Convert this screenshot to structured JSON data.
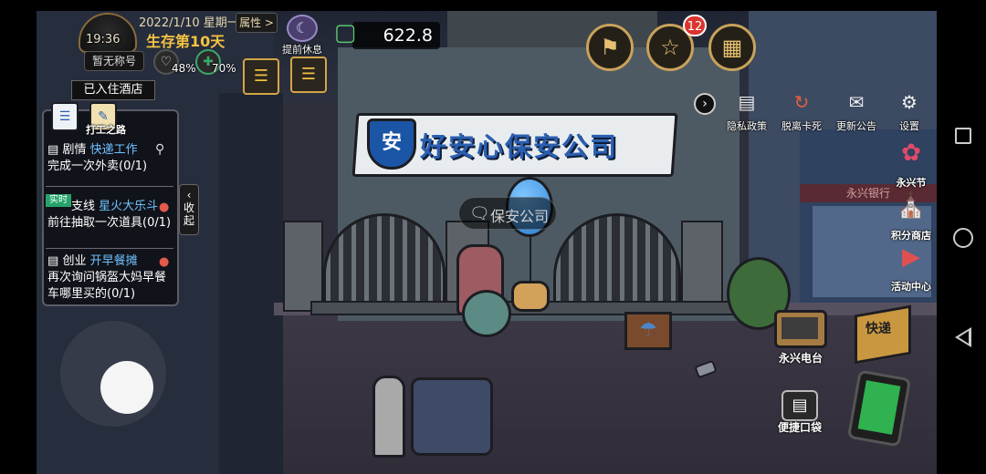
{
  "hud": {
    "time": "19:36",
    "date": "2022/1/10 星期一",
    "survival_day": "生存第10天",
    "attributes_label": "属性 >",
    "player_title": "暂无称号",
    "hunger_pct": "48%",
    "health_pct": "70%",
    "rest_label": "提前休息",
    "money": "622.8",
    "notification_count": "12"
  },
  "scene": {
    "company_sign": "好安心保安公司",
    "sign_emblem": "安",
    "location_bubble": "保安公司",
    "bank_sign": "永兴银行",
    "location_status": "已入住酒店"
  },
  "tasks": {
    "tab_label": "打工之路",
    "items": [
      {
        "type": "剧情",
        "name": "快递工作",
        "desc": "完成一次外卖(0/1)"
      },
      {
        "type": "支线",
        "name": "星火大乐斗",
        "desc": "前往抽取一次道具(0/1)",
        "tag": "实时"
      },
      {
        "type": "创业",
        "name": "开早餐摊",
        "desc": "再次询问锅盔大妈早餐车哪里买的(0/1)"
      }
    ],
    "collapse_label": "收起"
  },
  "top_menu": [
    {
      "label": "隐私政策",
      "icon": "document-icon"
    },
    {
      "label": "脱离卡死",
      "icon": "unstuck-icon"
    },
    {
      "label": "更新公告",
      "icon": "announcement-icon"
    },
    {
      "label": "设置",
      "icon": "gear-icon"
    }
  ],
  "side_buttons": [
    {
      "label": "永兴节",
      "icon": "festival-icon"
    },
    {
      "label": "积分商店",
      "icon": "shop-icon"
    },
    {
      "label": "活动中心",
      "icon": "event-icon"
    }
  ],
  "bottom_buttons": {
    "radio_label": "永兴电台",
    "box_label": "快递",
    "pocket_label": "便捷口袋"
  },
  "colors": {
    "gold": "#d2a648",
    "task_name": "#6fc3ff",
    "survival": "#f3c242",
    "badge_red": "#d9352e"
  }
}
